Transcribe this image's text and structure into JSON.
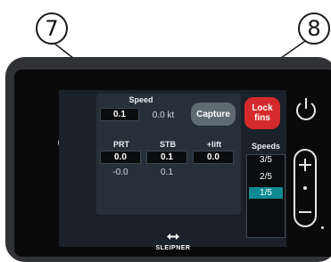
{
  "callouts": {
    "left": "7",
    "right": "8"
  },
  "nav": {
    "home_icon": "home-icon",
    "back_icon": "back-arrow-icon"
  },
  "speed": {
    "label": "Speed",
    "setpoint": "0.1",
    "actual": "0.0 kt"
  },
  "buttons": {
    "capture": "Capture",
    "lock_fins_line1": "Lock",
    "lock_fins_line2": "fins"
  },
  "columns": {
    "prt": "PRT",
    "stb": "STB",
    "lift": "+lift"
  },
  "values": {
    "prt": "0.0",
    "stb": "0.1",
    "lift": "0.0",
    "prt_actual": "-0.0",
    "stb_actual": "0.1"
  },
  "speeds": {
    "header": "Speeds",
    "items": [
      "3/5",
      "2/5",
      "1/5"
    ],
    "selected": "1/5"
  },
  "brand": {
    "name": "SLEIPNER"
  },
  "colors": {
    "accent": "#0f8a93",
    "lock_red": "#d42a2c",
    "capture_grey": "#5e6b73"
  }
}
